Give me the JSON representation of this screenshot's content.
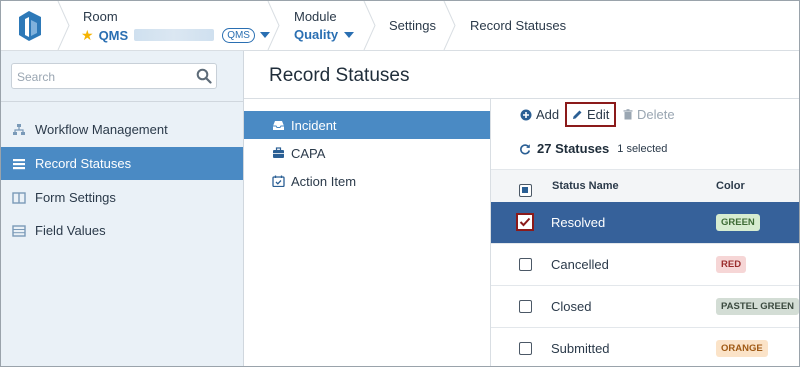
{
  "header": {
    "room_label": "Room",
    "room_code": "QMS",
    "room_badge": "QMS",
    "module_label": "Module",
    "module_value": "Quality",
    "crumb_settings": "Settings",
    "crumb_current": "Record Statuses"
  },
  "sidebar": {
    "search_placeholder": "Search",
    "items": [
      {
        "label": "Workflow Management",
        "icon": "sitemap-icon"
      },
      {
        "label": "Record Statuses",
        "icon": "list-icon",
        "active": true
      },
      {
        "label": "Form Settings",
        "icon": "columns-icon"
      },
      {
        "label": "Field Values",
        "icon": "table-icon"
      }
    ]
  },
  "main": {
    "title": "Record Statuses",
    "record_types": [
      {
        "label": "Incident",
        "icon": "inbox-icon",
        "active": true
      },
      {
        "label": "CAPA",
        "icon": "briefcase-icon"
      },
      {
        "label": "Action Item",
        "icon": "calendar-check-icon"
      }
    ],
    "toolbar": {
      "add": "Add",
      "edit": "Edit",
      "delete": "Delete"
    },
    "count_text": "27 Statuses",
    "selected_text": "1 selected",
    "columns": {
      "status_name": "Status Name",
      "color": "Color"
    },
    "rows": [
      {
        "name": "Resolved",
        "color": "GREEN",
        "selected": true
      },
      {
        "name": "Cancelled",
        "color": "RED",
        "selected": false
      },
      {
        "name": "Closed",
        "color": "PASTEL GREEN",
        "selected": false
      },
      {
        "name": "Submitted",
        "color": "ORANGE",
        "selected": false
      }
    ]
  },
  "colors": {
    "accent": "#4a8ac4",
    "selected_row": "#36619a",
    "link": "#2a6fb2",
    "highlight_box": "#8b1a1a",
    "badge_green_bg": "#d7ecd0",
    "badge_red_bg": "#f6d6d6",
    "badge_pastel_green_bg": "#d3ddd5",
    "badge_orange_bg": "#fbe3c8"
  }
}
